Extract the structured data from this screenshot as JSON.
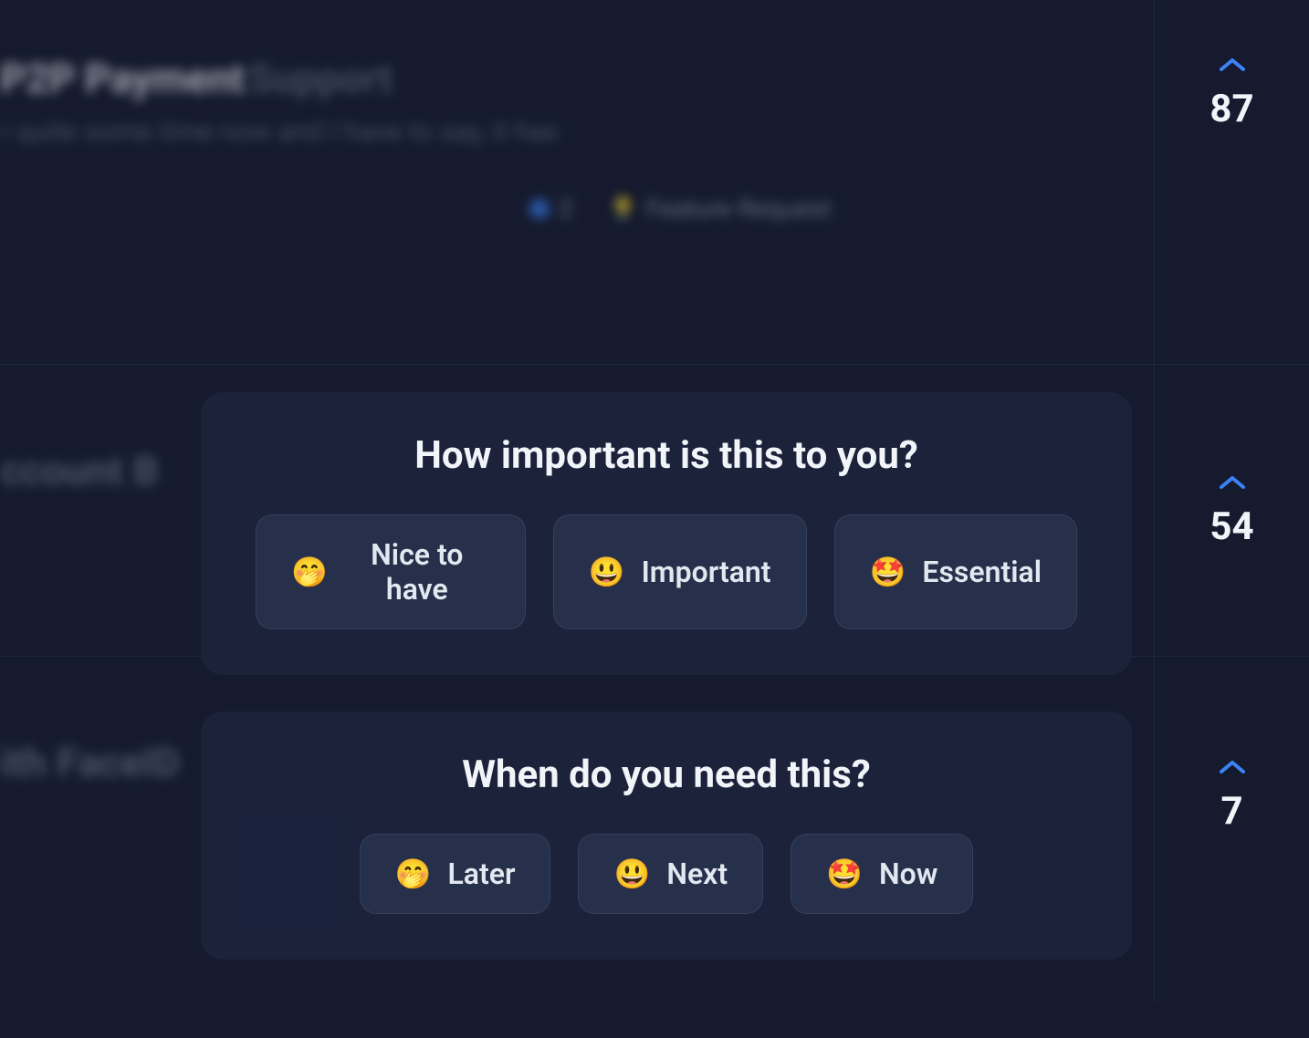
{
  "rows": [
    {
      "title_strong": "P2P Payment",
      "title_light": "Support",
      "subtitle": "r quite some time now and I have to say, it has",
      "comments_count": "2",
      "tag_label": "Feature Request",
      "votes": "87"
    },
    {
      "title_fragment": "ccount B",
      "votes": "54"
    },
    {
      "title_fragment": "ith FaceID",
      "votes": "7"
    }
  ],
  "prompts": {
    "importance": {
      "title": "How important is this to you?",
      "options": [
        {
          "emoji": "🤭",
          "label": "Nice to have"
        },
        {
          "emoji": "😃",
          "label": "Important"
        },
        {
          "emoji": "🤩",
          "label": "Essential"
        }
      ]
    },
    "timing": {
      "title": "When do you need this?",
      "options": [
        {
          "emoji": "🤭",
          "label": "Later"
        },
        {
          "emoji": "😃",
          "label": "Next"
        },
        {
          "emoji": "🤩",
          "label": "Now"
        }
      ]
    }
  }
}
